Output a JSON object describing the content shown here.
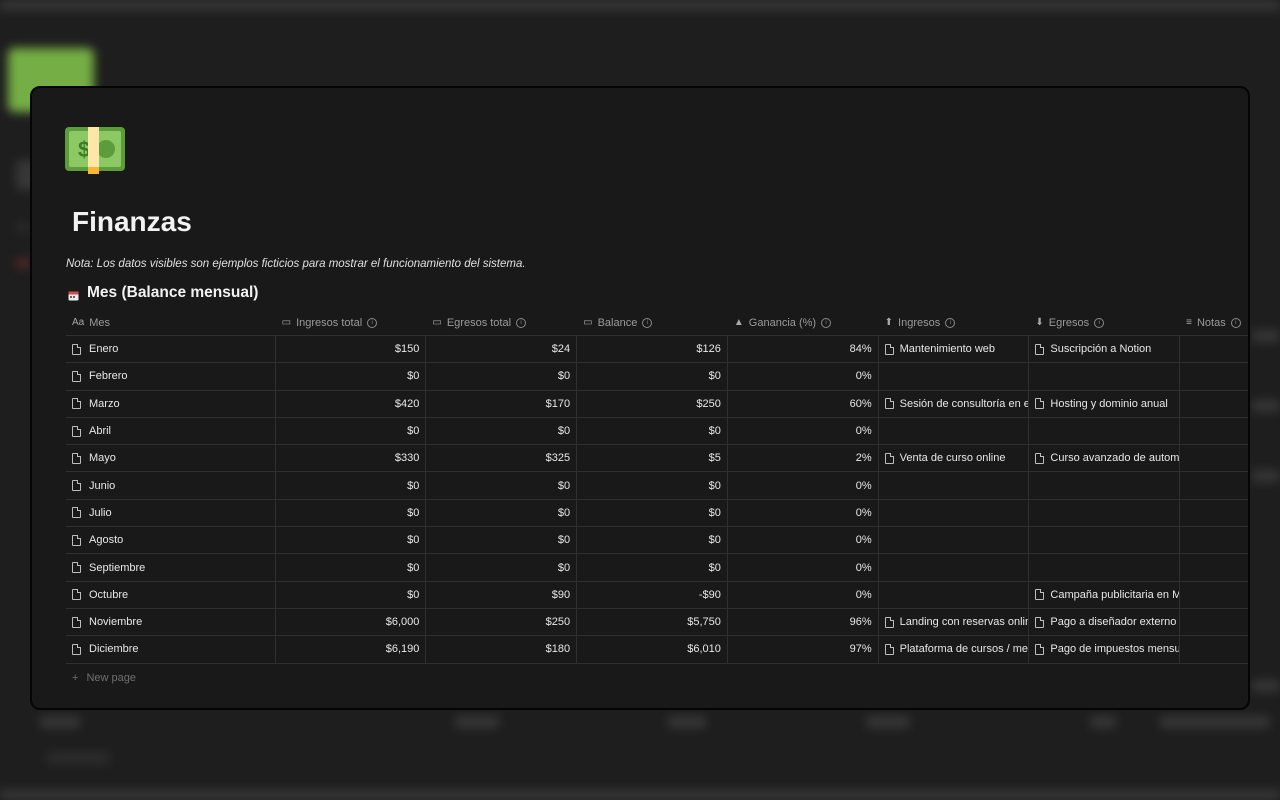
{
  "page": {
    "title": "Finanzas",
    "note": "Nota: Los datos visibles son ejemplos ficticios para mostrar el funcionamiento del sistema.",
    "page_icon": "money-banknote-icon"
  },
  "database": {
    "title": "Mes (Balance mensual)",
    "icon": "calendar-icon",
    "new_page_label": "New page",
    "columns": [
      {
        "label": "Mes",
        "icon": "title-icon"
      },
      {
        "label": "Ingresos total",
        "icon": "money-icon"
      },
      {
        "label": "Egresos total",
        "icon": "money-icon"
      },
      {
        "label": "Balance",
        "icon": "money-wings-icon"
      },
      {
        "label": "Ganancia (%)",
        "icon": "moneybag-icon"
      },
      {
        "label": "Ingresos",
        "icon": "arrow-up-circle-icon"
      },
      {
        "label": "Egresos",
        "icon": "arrow-down-circle-icon"
      },
      {
        "label": "Notas",
        "icon": "text-lines-icon"
      }
    ],
    "rows": [
      {
        "mes": "Enero",
        "ingresos_total": "$150",
        "egresos_total": "$24",
        "balance": "$126",
        "ganancia": "84%",
        "ingresos": [
          "Mantenimiento web"
        ],
        "egresos": [
          "Suscripción a Notion"
        ]
      },
      {
        "mes": "Febrero",
        "ingresos_total": "$0",
        "egresos_total": "$0",
        "balance": "$0",
        "ganancia": "0%",
        "ingresos": [],
        "egresos": []
      },
      {
        "mes": "Marzo",
        "ingresos_total": "$420",
        "egresos_total": "$170",
        "balance": "$250",
        "ganancia": "60%",
        "ingresos": [
          "Sesión de consultoría en es"
        ],
        "egresos": [
          "Hosting y dominio anual"
        ]
      },
      {
        "mes": "Abril",
        "ingresos_total": "$0",
        "egresos_total": "$0",
        "balance": "$0",
        "ganancia": "0%",
        "ingresos": [],
        "egresos": []
      },
      {
        "mes": "Mayo",
        "ingresos_total": "$330",
        "egresos_total": "$325",
        "balance": "$5",
        "ganancia": "2%",
        "ingresos": [
          "Venta de curso online"
        ],
        "egresos": [
          "Curso avanzado de automa"
        ]
      },
      {
        "mes": "Junio",
        "ingresos_total": "$0",
        "egresos_total": "$0",
        "balance": "$0",
        "ganancia": "0%",
        "ingresos": [],
        "egresos": []
      },
      {
        "mes": "Julio",
        "ingresos_total": "$0",
        "egresos_total": "$0",
        "balance": "$0",
        "ganancia": "0%",
        "ingresos": [],
        "egresos": []
      },
      {
        "mes": "Agosto",
        "ingresos_total": "$0",
        "egresos_total": "$0",
        "balance": "$0",
        "ganancia": "0%",
        "ingresos": [],
        "egresos": []
      },
      {
        "mes": "Septiembre",
        "ingresos_total": "$0",
        "egresos_total": "$0",
        "balance": "$0",
        "ganancia": "0%",
        "ingresos": [],
        "egresos": []
      },
      {
        "mes": "Octubre",
        "ingresos_total": "$0",
        "egresos_total": "$90",
        "balance": "-$90",
        "ganancia": "0%",
        "ingresos": [],
        "egresos": [
          "Campaña publicitaria en M"
        ]
      },
      {
        "mes": "Noviembre",
        "ingresos_total": "$6,000",
        "egresos_total": "$250",
        "balance": "$5,750",
        "ganancia": "96%",
        "ingresos": [
          "Landing con reservas online"
        ],
        "egresos": [
          "Pago a diseñador externo"
        ]
      },
      {
        "mes": "Diciembre",
        "ingresos_total": "$6,190",
        "egresos_total": "$180",
        "balance": "$6,010",
        "ganancia": "97%",
        "ingresos": [
          "Plataforma de cursos / mem"
        ],
        "egresos": [
          "Pago de impuestos mensua"
        ]
      }
    ]
  },
  "colors": {
    "background": "#191919",
    "text": "#e6e6e6",
    "muted": "#9b9b9b",
    "border": "#2f2f2f"
  }
}
